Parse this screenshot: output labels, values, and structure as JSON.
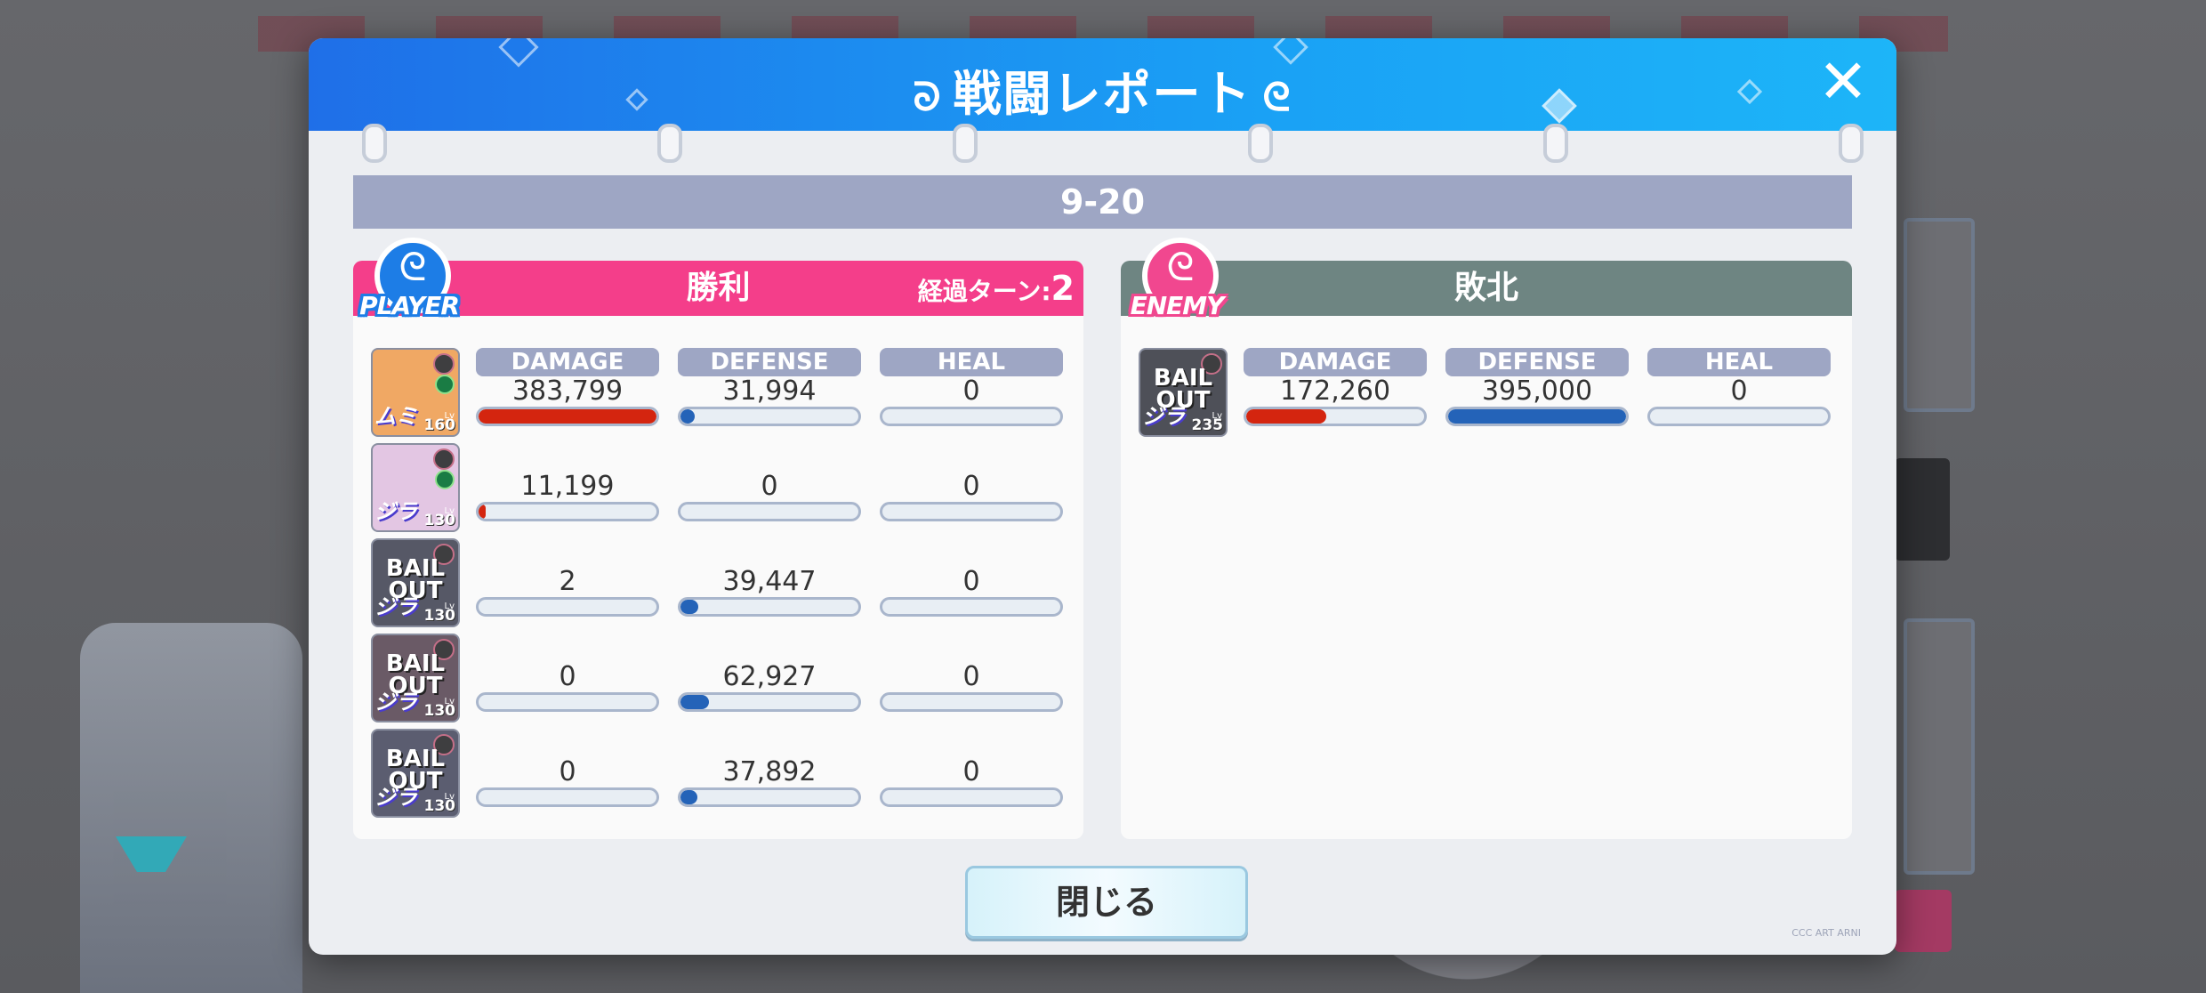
{
  "modal": {
    "title": "戦闘レポート",
    "close_glyph": "✕",
    "stage": "9-20",
    "close_button_label": "閉じる",
    "copyright": "CCC ART ARNI"
  },
  "player": {
    "badge": "PLAYER",
    "result": "勝利",
    "turn_label": "経過ターン:",
    "turns": "2",
    "header_color": "#f43e8a",
    "columns": [
      "DAMAGE",
      "DEFENSE",
      "HEAL"
    ],
    "units": [
      {
        "portrait": "character-1",
        "level": "160",
        "attr": "ムミ",
        "bail_out": false,
        "portrait_color": "#f0a864",
        "damage": "383,799",
        "defense": "31,994",
        "heal": "0",
        "damage_ratio": 1.0,
        "defense_ratio": 0.081,
        "heal_ratio": 0
      },
      {
        "portrait": "character-2",
        "level": "130",
        "attr": "ジラ",
        "bail_out": false,
        "portrait_color": "#e3c6e3",
        "damage": "11,199",
        "defense": "0",
        "heal": "0",
        "damage_ratio": 0.029,
        "defense_ratio": 0,
        "heal_ratio": 0
      },
      {
        "portrait": "character-3",
        "level": "130",
        "attr": "ジラ",
        "bail_out": true,
        "bail_out_text": "BAIL OUT",
        "portrait_color": "#565866",
        "damage": "2",
        "defense": "39,447",
        "heal": "0",
        "damage_ratio": 0,
        "defense_ratio": 0.1,
        "heal_ratio": 0
      },
      {
        "portrait": "character-4",
        "level": "130",
        "attr": "ジラ",
        "bail_out": true,
        "bail_out_text": "BAIL OUT",
        "portrait_color": "#6a5a66",
        "damage": "0",
        "defense": "62,927",
        "heal": "0",
        "damage_ratio": 0,
        "defense_ratio": 0.159,
        "heal_ratio": 0
      },
      {
        "portrait": "character-5",
        "level": "130",
        "attr": "ジラ",
        "bail_out": true,
        "bail_out_text": "BAIL OUT",
        "portrait_color": "#5b5d70",
        "damage": "0",
        "defense": "37,892",
        "heal": "0",
        "damage_ratio": 0,
        "defense_ratio": 0.096,
        "heal_ratio": 0
      }
    ]
  },
  "enemy": {
    "badge": "ENEMY",
    "result": "敗北",
    "header_color": "#6e8582",
    "columns": [
      "DAMAGE",
      "DEFENSE",
      "HEAL"
    ],
    "units": [
      {
        "portrait": "enemy-1",
        "level": "235",
        "attr": "ジラ",
        "bail_out": true,
        "bail_out_text": "BAIL OUT",
        "portrait_color": "#4e5058",
        "damage": "172,260",
        "defense": "395,000",
        "heal": "0",
        "damage_ratio": 0.449,
        "defense_ratio": 1.0,
        "heal_ratio": 0
      }
    ]
  },
  "colors": {
    "damage_bar": "#d4250f",
    "defense_bar": "#2463b8",
    "header_blue": "#1f6fe8"
  }
}
